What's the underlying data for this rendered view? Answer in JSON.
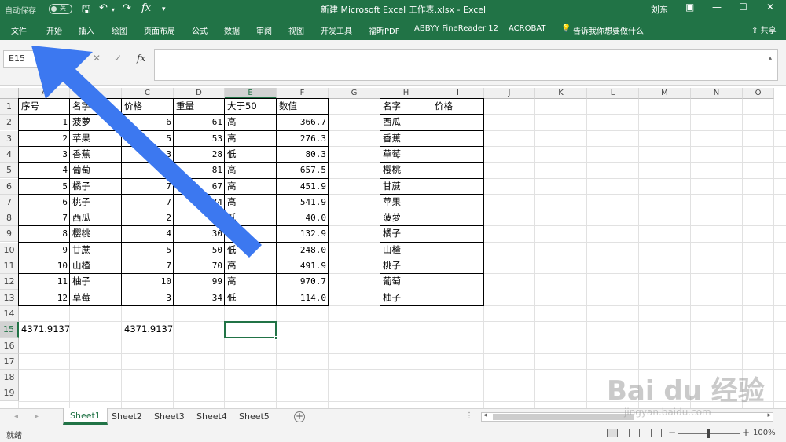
{
  "window": {
    "autosave_label": "自动保存",
    "autosave_state": "关",
    "title": "新建 Microsoft Excel 工作表.xlsx  -  Excel",
    "user": "刘东"
  },
  "ribbon": {
    "tabs": [
      "文件",
      "开始",
      "插入",
      "绘图",
      "页面布局",
      "公式",
      "数据",
      "审阅",
      "视图",
      "开发工具",
      "福昕PDF",
      "ABBYY FineReader 12",
      "ACROBAT"
    ],
    "tell_me": "告诉我你想要做什么",
    "share": "共享"
  },
  "formula_bar": {
    "name_box": "E15",
    "fx": "fx",
    "value": ""
  },
  "grid": {
    "columns": [
      "A",
      "B",
      "C",
      "D",
      "E",
      "F",
      "G",
      "H",
      "I",
      "J",
      "K",
      "L",
      "M",
      "N",
      "O"
    ],
    "rows": [
      "1",
      "2",
      "3",
      "4",
      "5",
      "6",
      "7",
      "8",
      "9",
      "10",
      "11",
      "12",
      "13",
      "14",
      "15",
      "16",
      "17",
      "18",
      "19"
    ],
    "selected_cell": "E15",
    "table1": {
      "headers": [
        "序号",
        "名字",
        "价格",
        "重量",
        "大于50",
        "数值"
      ],
      "rows": [
        [
          "1",
          "菠萝",
          "6",
          "61",
          "高",
          "366.7"
        ],
        [
          "2",
          "苹果",
          "5",
          "53",
          "高",
          "276.3"
        ],
        [
          "3",
          "香蕉",
          "3",
          "28",
          "低",
          "80.3"
        ],
        [
          "4",
          "葡萄",
          "8",
          "81",
          "高",
          "657.5"
        ],
        [
          "5",
          "橘子",
          "7",
          "67",
          "高",
          "451.9"
        ],
        [
          "6",
          "桃子",
          "7",
          "74",
          "高",
          "541.9"
        ],
        [
          "7",
          "西瓜",
          "2",
          "20",
          "低",
          "40.0"
        ],
        [
          "8",
          "樱桃",
          "4",
          "30",
          "低",
          "132.9"
        ],
        [
          "9",
          "甘蔗",
          "5",
          "50",
          "低",
          "248.0"
        ],
        [
          "10",
          "山楂",
          "7",
          "70",
          "高",
          "491.9"
        ],
        [
          "11",
          "柚子",
          "10",
          "99",
          "高",
          "970.7"
        ],
        [
          "12",
          "草莓",
          "3",
          "34",
          "低",
          "114.0"
        ]
      ]
    },
    "row15": {
      "A": "4371.9137",
      "C": "4371.9137"
    },
    "table2": {
      "headers": [
        "名字",
        "价格"
      ],
      "rows": [
        "西瓜",
        "香蕉",
        "草莓",
        "樱桃",
        "甘蔗",
        "苹果",
        "菠萝",
        "橘子",
        "山楂",
        "桃子",
        "葡萄",
        "柚子"
      ]
    }
  },
  "sheets": {
    "tabs": [
      "Sheet1",
      "Sheet2",
      "Sheet3",
      "Sheet4",
      "Sheet5"
    ],
    "active": "Sheet1"
  },
  "status": {
    "ready": "就绪",
    "zoom": "100%"
  },
  "colors": {
    "excel_green": "#217346",
    "arrow_blue": "#3C78F0"
  },
  "watermark": {
    "brand": "Bai du 经验",
    "url": "jingyan.baidu.com"
  }
}
